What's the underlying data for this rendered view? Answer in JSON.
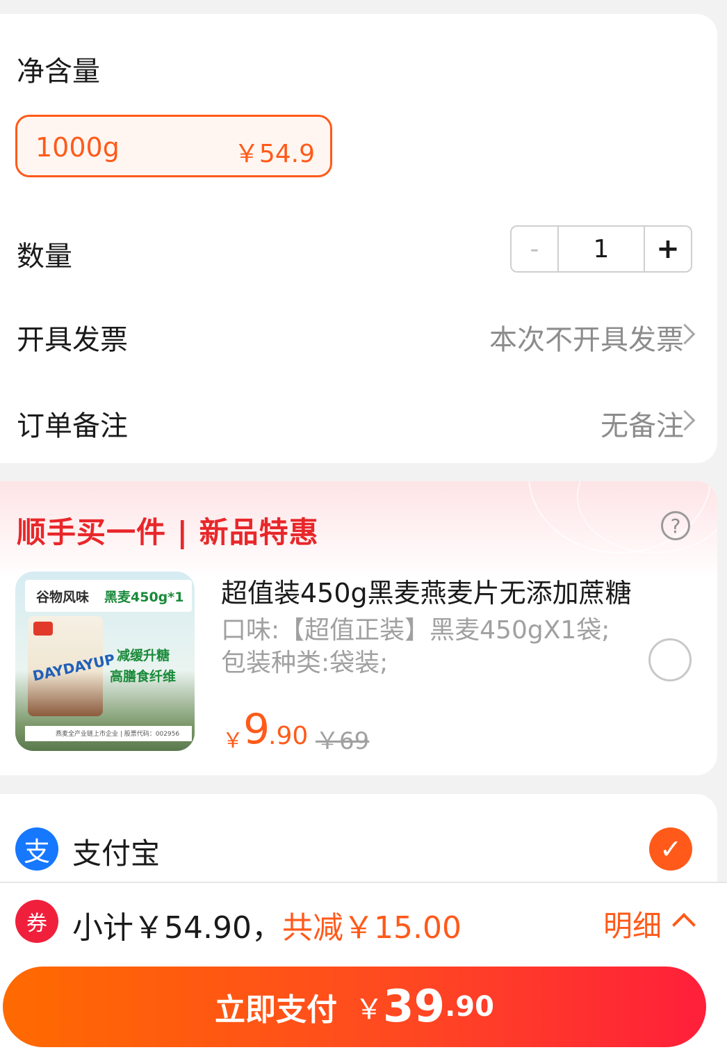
{
  "spec": {
    "section_label": "净含量",
    "option": {
      "weight": "1000g",
      "price": "￥54.9"
    }
  },
  "quantity": {
    "label": "数量",
    "minus": "-",
    "value": "1",
    "plus": "+"
  },
  "invoice": {
    "label": "开具发票",
    "value": "本次不开具发票"
  },
  "remark": {
    "label": "订单备注",
    "value": "无备注"
  },
  "promo": {
    "title": "顺手买一件 | 新品特惠",
    "help_icon": "?",
    "image": {
      "tag1": "谷物风味",
      "tag2": "黑麦450g*1",
      "brand": "DAYDAYUP",
      "text1": "减缓升糖",
      "text2": "高膳食纤维",
      "footer": "燕麦全产业链上市企业 | 股票代码：002956"
    },
    "product_title": "超值装450g黑麦燕麦片无添加蔗糖",
    "attr1": "口味:【超值正装】黑麦450gX1袋;",
    "attr2": "包装种类:袋装;",
    "price_symbol": "￥",
    "price_int": "9",
    "price_dec": ".90",
    "orig_price": "￥69"
  },
  "payment": {
    "method": "支付宝",
    "icon": "支",
    "check": "✓"
  },
  "summary": {
    "coupon_icon": "券",
    "subtotal": "小计￥54.90，",
    "discount": "共减￥15.00",
    "detail": "明细"
  },
  "pay_button": {
    "label": "立即支付",
    "symbol": "￥",
    "amount_int": "39",
    "amount_dec": ".90"
  },
  "colors": {
    "accent": "#ff5a1a",
    "promo_red": "#e8272a",
    "alipay": "#1677ff"
  }
}
